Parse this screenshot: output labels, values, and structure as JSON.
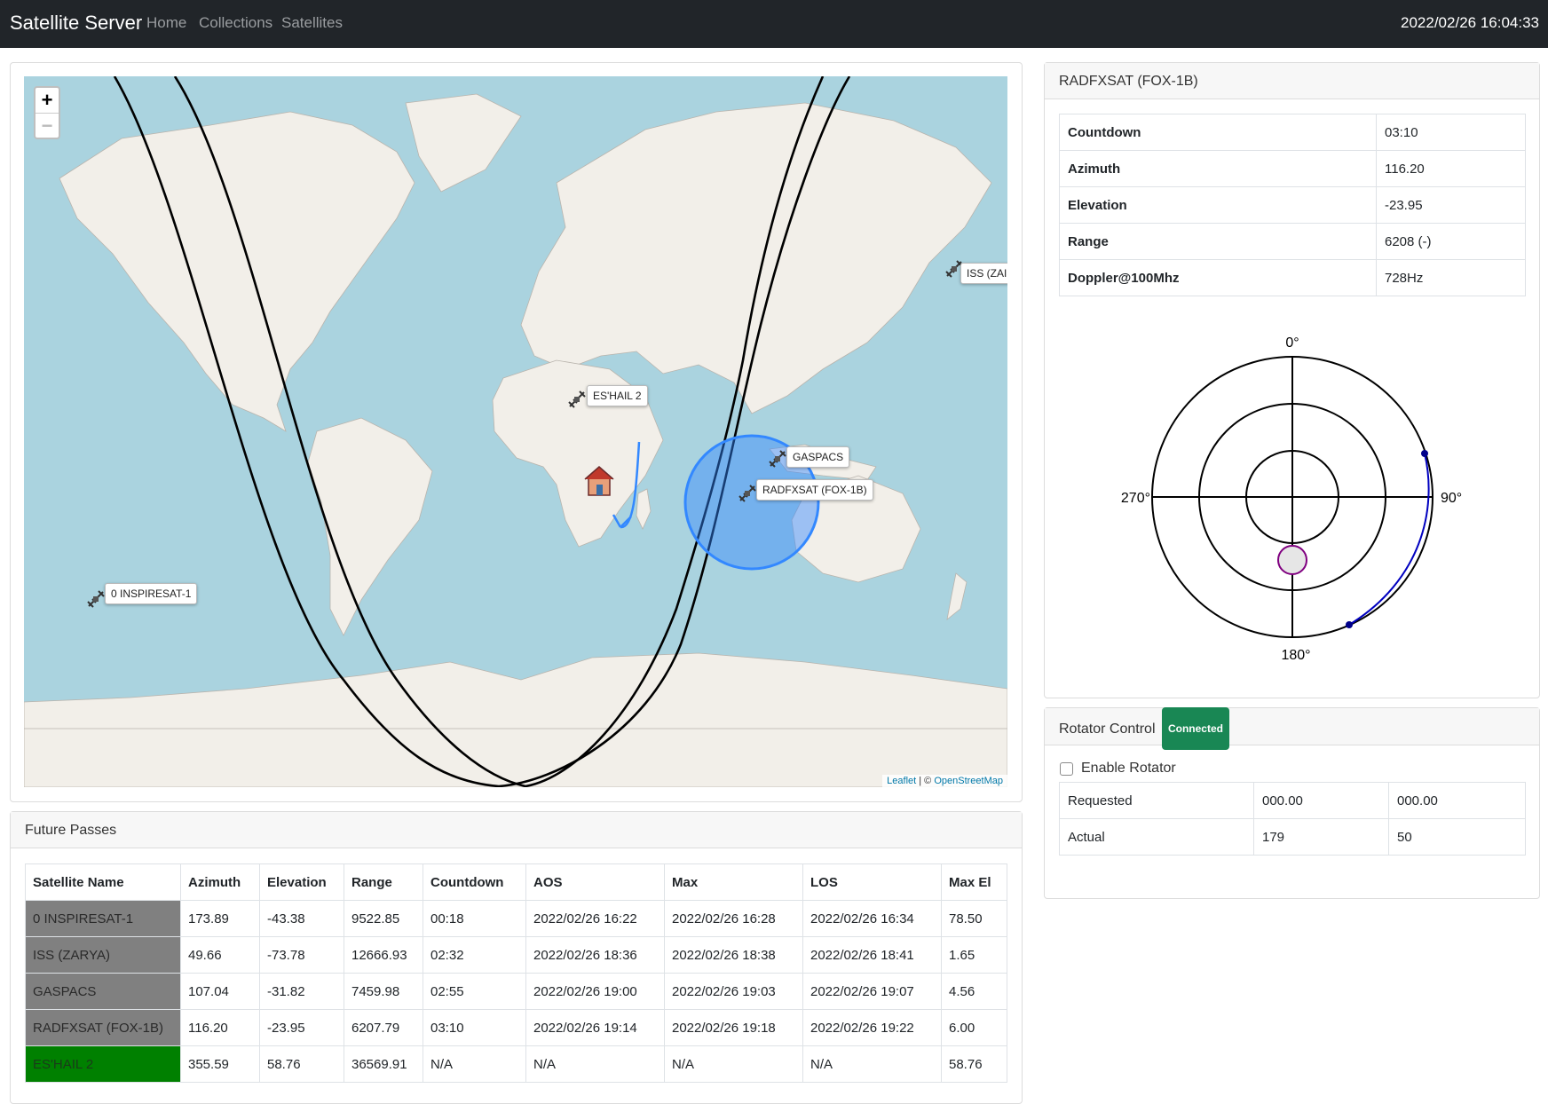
{
  "navbar": {
    "brand": "Satellite Server",
    "links": [
      "Home",
      "Collections",
      "Satellites"
    ],
    "datetime": "2022/02/26 16:04:33"
  },
  "map": {
    "zoom_in": "+",
    "zoom_out": "−",
    "satellites": [
      {
        "label": "ISS (ZAI"
      },
      {
        "label": "ES'HAIL 2"
      },
      {
        "label": "GASPACS"
      },
      {
        "label": "RADFXSAT (FOX-1B)"
      },
      {
        "label": "0 INSPIRESAT-1"
      }
    ],
    "attribution_leaflet": "Leaflet",
    "attribution_sep": " | © ",
    "attribution_osm": "OpenStreetMap"
  },
  "selected": {
    "title": "RADFXSAT (FOX-1B)",
    "rows": [
      {
        "key": "Countdown",
        "value": "03:10"
      },
      {
        "key": "Azimuth",
        "value": "116.20"
      },
      {
        "key": "Elevation",
        "value": "-23.95"
      },
      {
        "key": "Range",
        "value": "6208 (-)"
      },
      {
        "key": "Doppler@100Mhz",
        "value": "728Hz"
      }
    ],
    "polar": {
      "north": "0°",
      "east": "90°",
      "south": "180°",
      "west": "270°"
    }
  },
  "rotator": {
    "title": "Rotator Control",
    "status": "Connected",
    "enable_label": "Enable Rotator",
    "rows": [
      {
        "label": "Requested",
        "az": "000.00",
        "el": "000.00"
      },
      {
        "label": "Actual",
        "az": "179",
        "el": "50"
      }
    ]
  },
  "passes": {
    "title": "Future Passes",
    "headers": [
      "Satellite Name",
      "Azimuth",
      "Elevation",
      "Range",
      "Countdown",
      "AOS",
      "Max",
      "LOS",
      "Max El"
    ],
    "rows": [
      [
        "0 INSPIRESAT-1",
        "173.89",
        "-43.38",
        "9522.85",
        "00:18",
        "2022/02/26 16:22",
        "2022/02/26 16:28",
        "2022/02/26 16:34",
        "78.50"
      ],
      [
        "ISS (ZARYA)",
        "49.66",
        "-73.78",
        "12666.93",
        "02:32",
        "2022/02/26 18:36",
        "2022/02/26 18:38",
        "2022/02/26 18:41",
        "1.65"
      ],
      [
        "GASPACS",
        "107.04",
        "-31.82",
        "7459.98",
        "02:55",
        "2022/02/26 19:00",
        "2022/02/26 19:03",
        "2022/02/26 19:07",
        "4.56"
      ],
      [
        "RADFXSAT (FOX-1B)",
        "116.20",
        "-23.95",
        "6207.79",
        "03:10",
        "2022/02/26 19:14",
        "2022/02/26 19:18",
        "2022/02/26 19:22",
        "6.00"
      ],
      [
        "ES'HAIL 2",
        "355.59",
        "58.76",
        "36569.91",
        "N/A",
        "N/A",
        "N/A",
        "N/A",
        "58.76"
      ]
    ],
    "visible_row": 4
  },
  "colors": {
    "navbar": "#212529",
    "ocean": "#aad3df",
    "land": "#f2efe9",
    "footprint": "#3388ff",
    "visible": "#008000",
    "below_horizon": "#808080",
    "connected": "#198754"
  }
}
